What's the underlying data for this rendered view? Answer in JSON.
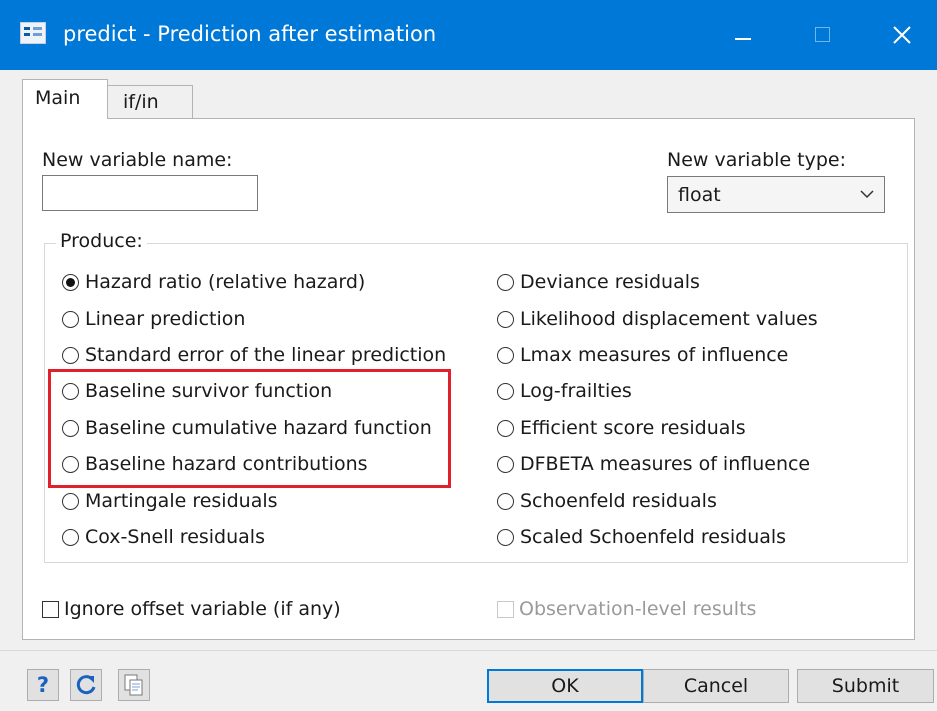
{
  "window": {
    "title": "predict - Prediction after estimation",
    "icon": "dialog-icon",
    "controls": [
      "minimize-icon",
      "maximize-icon",
      "close-icon"
    ]
  },
  "tabs": [
    {
      "label": "Main",
      "selected": true
    },
    {
      "label": "if/in",
      "selected": false
    }
  ],
  "new_var": {
    "label": "New variable name:",
    "value": ""
  },
  "var_type": {
    "label": "New variable type:",
    "selected": "float"
  },
  "produce": {
    "label": "Produce:",
    "left": [
      {
        "label": "Hazard ratio (relative hazard)",
        "checked": true
      },
      {
        "label": "Linear prediction",
        "checked": false
      },
      {
        "label": "Standard error of the linear prediction",
        "checked": false
      },
      {
        "label": "Baseline survivor function",
        "checked": false
      },
      {
        "label": "Baseline cumulative hazard function",
        "checked": false
      },
      {
        "label": "Baseline hazard contributions",
        "checked": false
      },
      {
        "label": "Martingale residuals",
        "checked": false
      },
      {
        "label": "Cox-Snell residuals",
        "checked": false
      }
    ],
    "right": [
      {
        "label": "Deviance residuals",
        "checked": false
      },
      {
        "label": "Likelihood displacement values",
        "checked": false
      },
      {
        "label": "Lmax measures of influence",
        "checked": false
      },
      {
        "label": "Log-frailties",
        "checked": false
      },
      {
        "label": "Efficient score residuals",
        "checked": false
      },
      {
        "label": "DFBETA measures of influence",
        "checked": false
      },
      {
        "label": "Schoenfeld residuals",
        "checked": false
      },
      {
        "label": "Scaled Schoenfeld residuals",
        "checked": false
      }
    ]
  },
  "options": {
    "ignore_offset": {
      "label": "Ignore offset variable (if any)",
      "checked": false,
      "enabled": true
    },
    "obs_level": {
      "label": "Observation-level results",
      "checked": false,
      "enabled": false
    }
  },
  "footer": {
    "help": "?",
    "reset_icon": "reset-icon",
    "copy_icon": "copy-command-icon",
    "ok": "OK",
    "cancel": "Cancel",
    "submit": "Submit"
  },
  "highlight_color": "#e0202a",
  "accent_color": "#0078d7"
}
